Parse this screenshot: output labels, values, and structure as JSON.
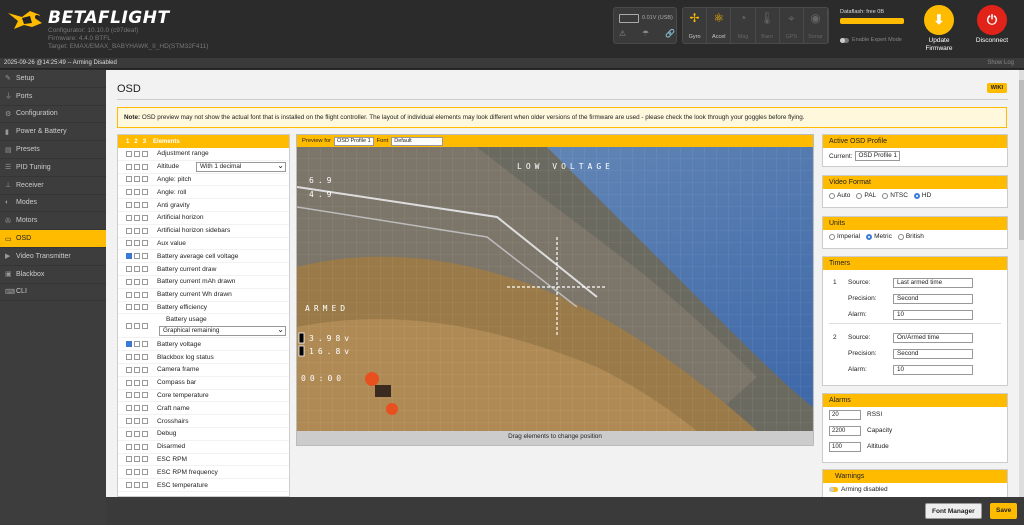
{
  "app": {
    "name": "BETAFLIGHT",
    "configurator": "Configurator: 10.10.0 (c97deaf)",
    "firmware": "Firmware: 4.4.0 BTFL",
    "target": "Target: EMAX/EMAX_BABYHAWK_II_HD(STM32F411)"
  },
  "status": {
    "voltage": "0.01V (USB)",
    "dataflash": "Dataflash: free 0B",
    "expert": "Enable Expert Mode",
    "update": "Update\nFirmware",
    "update_l1": "Update",
    "update_l2": "Firmware",
    "disconnect": "Disconnect",
    "timestamp": "2025-09-26 @14:25:49 -- Arming Disabled",
    "show_log": "Show Log"
  },
  "sensors": [
    {
      "label": "Gyro",
      "icon": "gyro-icon",
      "active": true
    },
    {
      "label": "Accel",
      "icon": "accel-icon",
      "active": true
    },
    {
      "label": "Mag",
      "icon": "mag-icon",
      "active": false
    },
    {
      "label": "Baro",
      "icon": "baro-icon",
      "active": false
    },
    {
      "label": "GPS",
      "icon": "gps-icon",
      "active": false
    },
    {
      "label": "Sonar",
      "icon": "sonar-icon",
      "active": false
    }
  ],
  "nav": [
    {
      "label": "Setup",
      "icon": "wrench-icon"
    },
    {
      "label": "Ports",
      "icon": "plug-icon"
    },
    {
      "label": "Configuration",
      "icon": "gear-icon"
    },
    {
      "label": "Power & Battery",
      "icon": "battery-icon"
    },
    {
      "label": "Presets",
      "icon": "folder-icon"
    },
    {
      "label": "PID Tuning",
      "icon": "sliders-icon"
    },
    {
      "label": "Receiver",
      "icon": "antenna-icon"
    },
    {
      "label": "Modes",
      "icon": "toggle-icon"
    },
    {
      "label": "Motors",
      "icon": "motor-icon"
    },
    {
      "label": "OSD",
      "icon": "screen-icon",
      "active": true
    },
    {
      "label": "Video Transmitter",
      "icon": "video-icon"
    },
    {
      "label": "Blackbox",
      "icon": "blackbox-icon"
    },
    {
      "label": "CLI",
      "icon": "terminal-icon"
    }
  ],
  "page": {
    "title": "OSD",
    "wiki": "WIKI",
    "note_bold": "Note:",
    "note": " OSD preview may not show the actual font that is installed on the flight controller. The layout of individual elements may look different when older versions of the firmware are used - please check the look through your goggles before flying."
  },
  "elements": {
    "header_profiles": [
      "1",
      "2",
      "3"
    ],
    "header": "Elements",
    "items": [
      {
        "name": "Adjustment range",
        "on": false
      },
      {
        "name": "Altitude",
        "on": false,
        "select": "With 1 decimal"
      },
      {
        "name": "Angle: pitch",
        "on": false
      },
      {
        "name": "Angle: roll",
        "on": false
      },
      {
        "name": "Anti gravity",
        "on": false
      },
      {
        "name": "Artificial horizon",
        "on": false
      },
      {
        "name": "Artificial horizon sidebars",
        "on": false
      },
      {
        "name": "Aux value",
        "on": false
      },
      {
        "name": "Battery average cell voltage",
        "on": true
      },
      {
        "name": "Battery current draw",
        "on": false
      },
      {
        "name": "Battery current mAh drawn",
        "on": false
      },
      {
        "name": "Battery current Wh drawn",
        "on": false
      },
      {
        "name": "Battery efficiency",
        "on": false
      },
      {
        "name": "Battery usage",
        "on": false,
        "select": "Graphical remaining",
        "tall": true
      },
      {
        "name": "Battery voltage",
        "on": true
      },
      {
        "name": "Blackbox log status",
        "on": false
      },
      {
        "name": "Camera frame",
        "on": false
      },
      {
        "name": "Compass bar",
        "on": false
      },
      {
        "name": "Core temperature",
        "on": false
      },
      {
        "name": "Craft name",
        "on": false
      },
      {
        "name": "Crosshairs",
        "on": false
      },
      {
        "name": "Debug",
        "on": false
      },
      {
        "name": "Disarmed",
        "on": false
      },
      {
        "name": "ESC RPM",
        "on": false
      },
      {
        "name": "ESC RPM frequency",
        "on": false
      },
      {
        "name": "ESC temperature",
        "on": false
      }
    ]
  },
  "preview": {
    "for_label": "Preview for",
    "profile": "OSD Profile 1",
    "font_label": "Font",
    "font": "Default",
    "drag_hint": "Drag elements to change position",
    "osd_warning": "LOW VOLTAGE",
    "osd_arm": "ARMED",
    "osd_cell": "3.98v",
    "osd_volt": "16.8v",
    "osd_time": "00:00",
    "osd_line1": "6.9",
    "osd_line2": "4.9"
  },
  "active_profile": {
    "title": "Active OSD Profile",
    "label": "Current:",
    "value": "OSD Profile 1"
  },
  "video_format": {
    "title": "Video Format",
    "options": [
      {
        "label": "Auto",
        "on": false
      },
      {
        "label": "PAL",
        "on": false
      },
      {
        "label": "NTSC",
        "on": false
      },
      {
        "label": "HD",
        "on": true
      }
    ]
  },
  "units": {
    "title": "Units",
    "options": [
      {
        "label": "Imperial",
        "on": false
      },
      {
        "label": "Metric",
        "on": true
      },
      {
        "label": "British",
        "on": false
      }
    ]
  },
  "timers": {
    "title": "Timers",
    "list": [
      {
        "num": "1",
        "source_label": "Source:",
        "source": "Last armed time",
        "precision_label": "Precision:",
        "precision": "Second",
        "alarm_label": "Alarm:",
        "alarm": "10"
      },
      {
        "num": "2",
        "source_label": "Source:",
        "source": "On/Armed time",
        "precision_label": "Precision:",
        "precision": "Second",
        "alarm_label": "Alarm:",
        "alarm": "10"
      }
    ]
  },
  "alarms": {
    "title": "Alarms",
    "list": [
      {
        "value": "20",
        "label": "RSSI"
      },
      {
        "value": "2200",
        "label": "Capacity"
      },
      {
        "value": "100",
        "label": "Altitude"
      }
    ]
  },
  "warnings": {
    "title": "Warnings",
    "item": "Arming disabled"
  },
  "footer": {
    "font_manager": "Font Manager",
    "save": "Save"
  },
  "colors": {
    "accent": "#ffbb00",
    "bg": "#2b2b2b",
    "nav": "#3d3d3d",
    "panel": "#f2f2f2",
    "update": "#ffbb00",
    "disconnect": "#e2231a"
  }
}
